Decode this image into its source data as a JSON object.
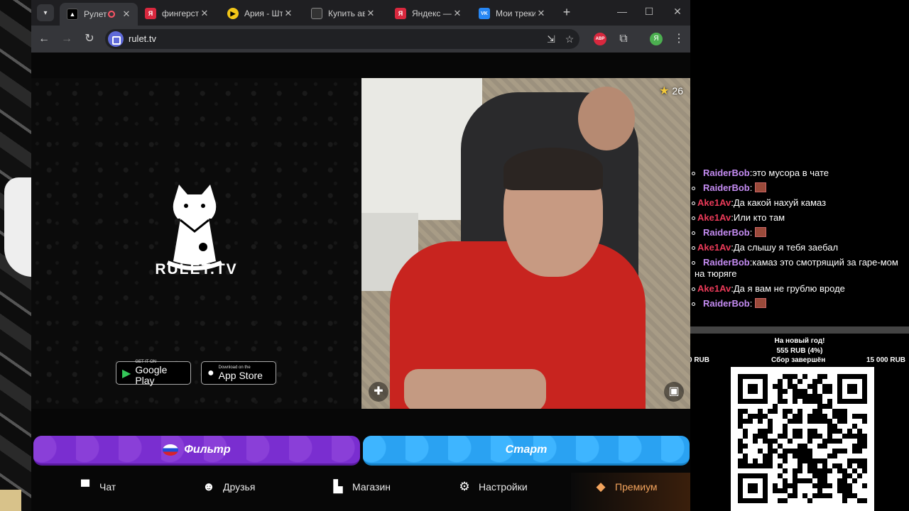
{
  "browser": {
    "tabs": [
      {
        "label": "Рулет ТВ",
        "favicon_color": "#000000",
        "active": true,
        "recording": true
      },
      {
        "label": "фингерстайл",
        "favicon_color": "#d8283e",
        "favicon_text": "Я"
      },
      {
        "label": "Ария - Шти",
        "favicon_color": "#f2c618"
      },
      {
        "label": "Купить ави",
        "favicon_color": "#333333"
      },
      {
        "label": "Яндекс — б",
        "favicon_color": "#d8283e",
        "favicon_text": "Я"
      },
      {
        "label": "Мои треки",
        "favicon_color": "#2787f5",
        "favicon_text": "VK"
      }
    ],
    "url": "rulet.tv",
    "extension_abp": "ABP",
    "profile_initial": "Я"
  },
  "promo": {
    "brand": "RULET.TV",
    "google_play": {
      "small": "GET IT ON",
      "big": "Google Play"
    },
    "app_store": {
      "small": "Download on the",
      "big": "App Store"
    }
  },
  "video": {
    "rating": "26"
  },
  "actions": {
    "filter_label": "Фильтр",
    "start_label": "Старт"
  },
  "nav": [
    {
      "label": "Чат",
      "icon": "chat-icon"
    },
    {
      "label": "Друзья",
      "icon": "friends-icon"
    },
    {
      "label": "Магазин",
      "icon": "shop-icon"
    },
    {
      "label": "Настройки",
      "icon": "gear-icon"
    },
    {
      "label": "Премиум",
      "icon": "tag-icon"
    }
  ],
  "colors": {
    "filter": "#7a2ed0",
    "start": "#2aa2f2",
    "premium": "#f3a45d",
    "user_raiderbob": "#c58cf3",
    "user_ake1av": "#ea3a58"
  },
  "chat": [
    {
      "user": "RaiderBob",
      "sep": ":",
      "text": "это мусора в чате",
      "emote": false
    },
    {
      "user": "RaiderBob",
      "sep": ":",
      "text": "",
      "emote": true
    },
    {
      "user": "Ake1Av",
      "sep": ":",
      "text": "Да какой нахуй камаз",
      "emote": false
    },
    {
      "user": "Ake1Av",
      "sep": ":",
      "text": "Или кто там",
      "emote": false
    },
    {
      "user": "RaiderBob",
      "sep": ":",
      "text": "",
      "emote": true
    },
    {
      "user": "Ake1Av",
      "sep": ":",
      "text": "Да слышу я тебя заебал",
      "emote": false
    },
    {
      "user": "RaiderBob",
      "sep": ":",
      "text": "камаз это смотрящий за гаре-мом на тюряге",
      "emote": false
    },
    {
      "user": "Ake1Av",
      "sep": ":",
      "text": "Да я вам не грублю вроде",
      "emote": false
    },
    {
      "user": "RaiderBob",
      "sep": ":",
      "text": "",
      "emote": true
    }
  ],
  "donation_goal": {
    "title": "На новый год!",
    "progress": "555 RUB (4%)",
    "min": "0 RUB",
    "status": "Сбор завершён",
    "max": "15 000 RUB",
    "progress_fraction": 0.04
  }
}
